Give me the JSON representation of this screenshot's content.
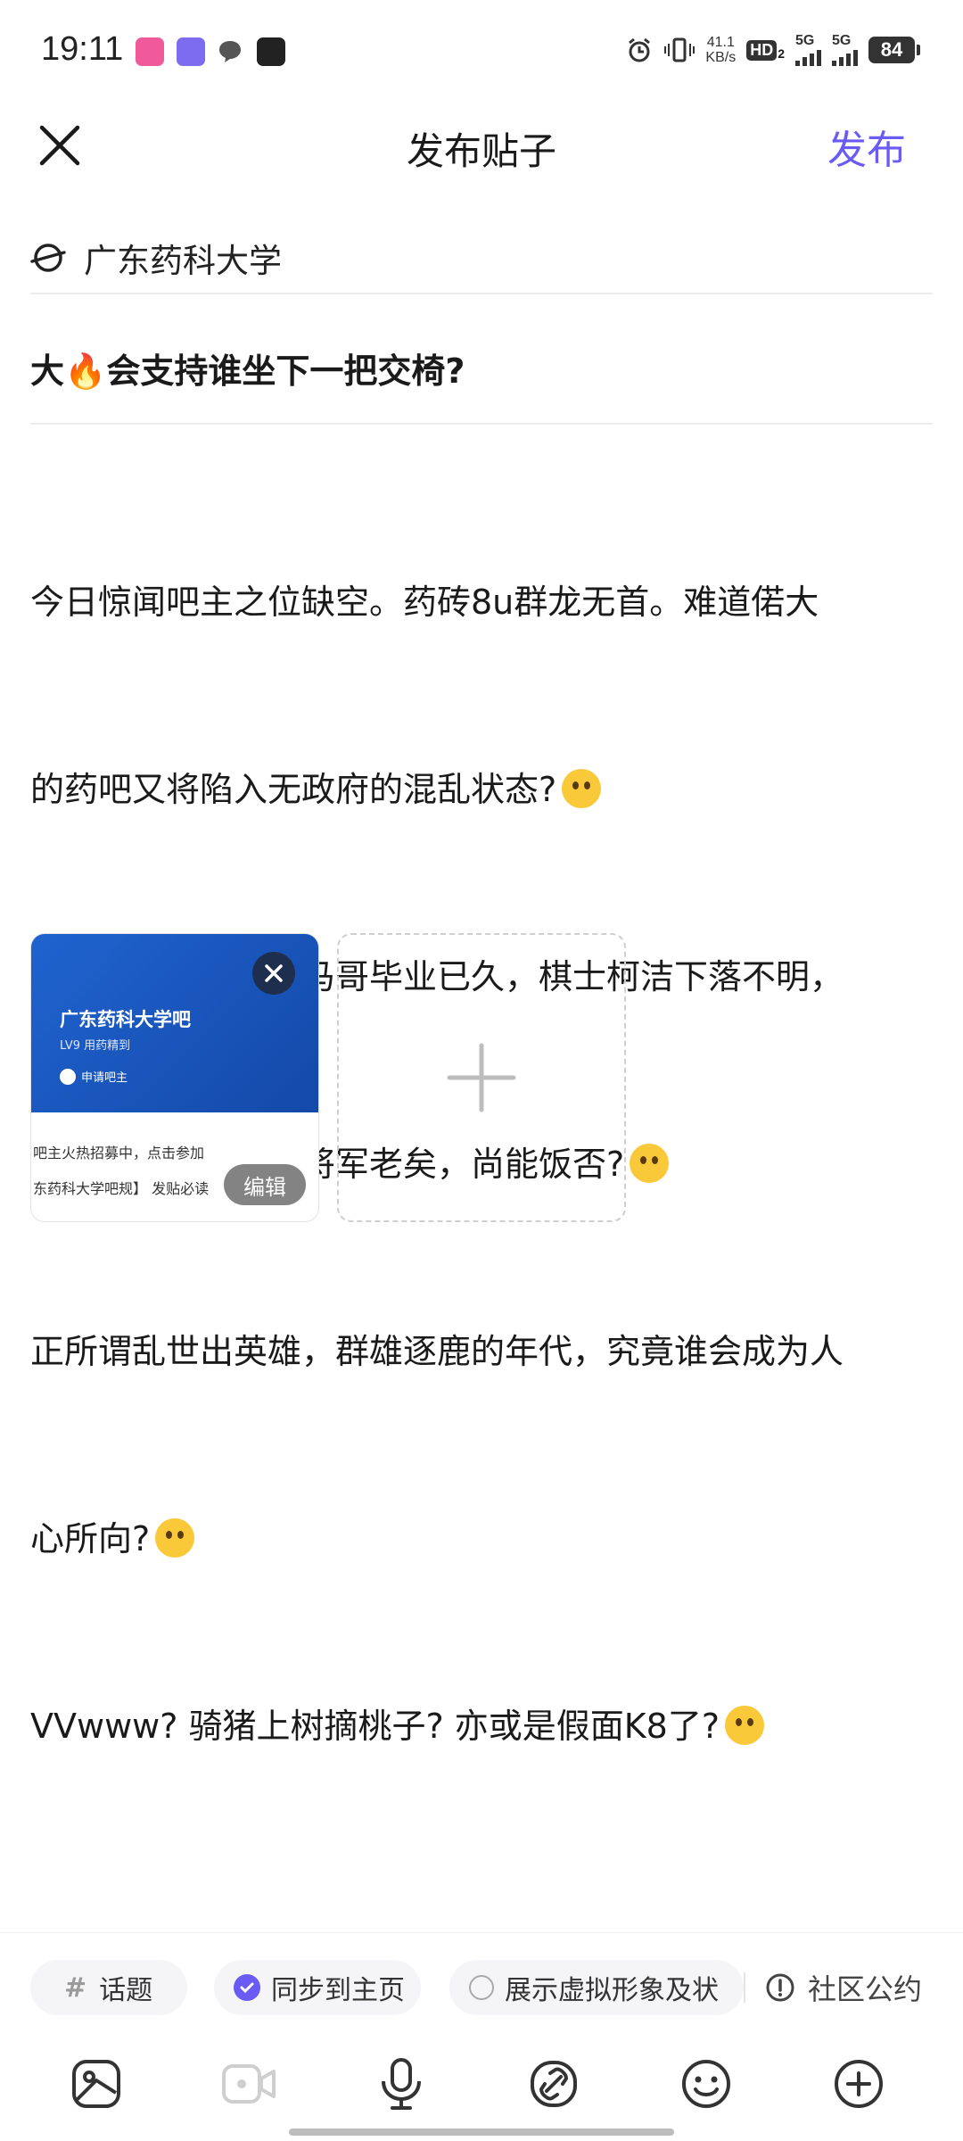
{
  "status_bar": {
    "time": "19:11",
    "net_speed_value": "41.1",
    "net_speed_unit": "KB/s",
    "hd_label": "HD",
    "hd_sub": "2",
    "signal1_label": "5G",
    "signal2_label": "5G",
    "battery": "84",
    "icons": [
      "app-icon-pink",
      "app-icon-purple",
      "chat-bubble-icon",
      "soul-app-icon",
      "alarm-icon",
      "vibrate-icon"
    ]
  },
  "header": {
    "title": "发布贴子",
    "publish_label": "发布"
  },
  "forum": {
    "name": "广东药科大学"
  },
  "post": {
    "title": "大🔥会支持谁坐下一把交椅?",
    "body_lines": [
      "今日惊闻吧主之位缺空。药砖8u群龙无首。难道偌大",
      "的药吧又将陷入无政府的混乱状态?",
      "纵观各朝元老，神马哥毕业已久，棋士柯洁下落不明，",
      "徐杰虎远赴华农。将军老矣，尚能饭否?",
      "正所谓乱世出英雄，群雄逐鹿的年代，究竟谁会成为人",
      "心所向?",
      "VVwww? 骑猪上树摘桃子? 亦或是假面K8了?"
    ]
  },
  "image": {
    "forum_name": "广东药科大学吧",
    "level": "LV9 用药精到",
    "apply": "申请吧主",
    "line1": "吧主火热招募中，点击参加",
    "line2": "东药科大学吧规】 发贴必读",
    "edit_label": "编辑"
  },
  "options": {
    "topic_label": "话题",
    "sync_label": "同步到主页",
    "avatar_label": "展示虚拟形象及状",
    "rules_label": "社区公约"
  },
  "toolbar": {
    "tools": [
      "image-icon",
      "video-icon",
      "microphone-icon",
      "link-icon",
      "emoji-icon",
      "more-plus-icon"
    ]
  },
  "colors": {
    "accent": "#6a5bf5",
    "image_blue": "#1f63cf"
  }
}
